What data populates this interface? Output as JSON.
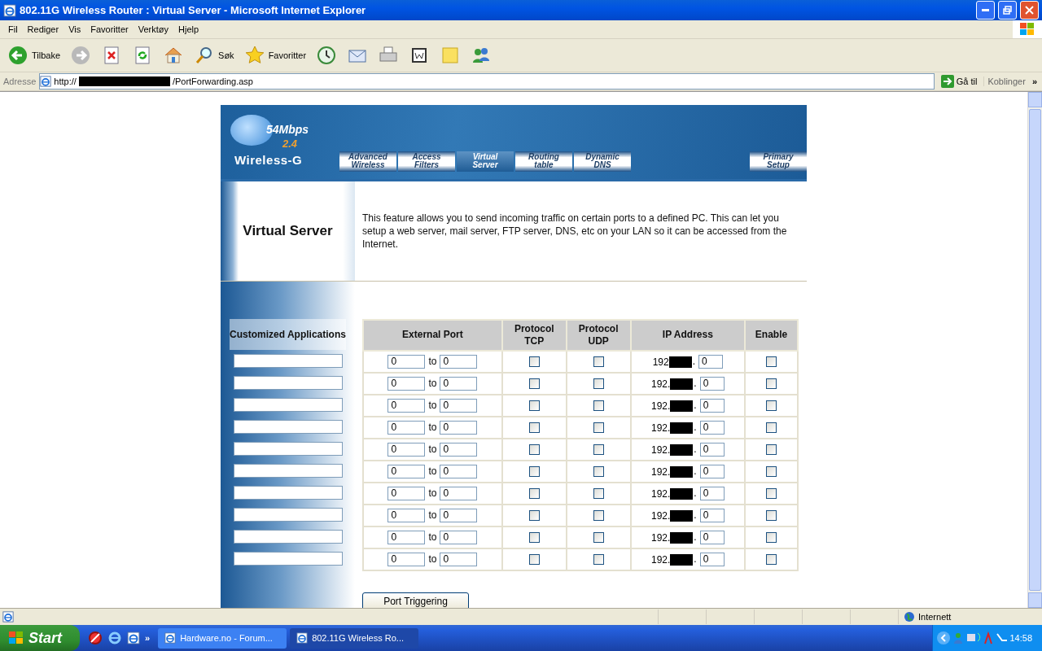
{
  "window": {
    "title": "802.11G Wireless Router : Virtual Server - Microsoft Internet Explorer"
  },
  "menu": [
    "Fil",
    "Rediger",
    "Vis",
    "Favoritter",
    "Verktøy",
    "Hjelp"
  ],
  "toolbar": [
    {
      "kind": "back",
      "label": "Tilbake"
    },
    {
      "kind": "forward"
    },
    {
      "kind": "stop"
    },
    {
      "kind": "refresh"
    },
    {
      "kind": "home"
    },
    {
      "kind": "search",
      "label": "Søk"
    },
    {
      "kind": "favorites",
      "label": "Favoritter"
    },
    {
      "kind": "history"
    },
    {
      "kind": "mail"
    },
    {
      "kind": "print"
    },
    {
      "kind": "edit"
    },
    {
      "kind": "note"
    },
    {
      "kind": "messenger"
    }
  ],
  "address": {
    "label": "Adresse",
    "url_prefix": "http://",
    "url_suffix": "/PortForwarding.asp",
    "go": "Gå til",
    "links": "Koblinger",
    "more": "»"
  },
  "router": {
    "logo": {
      "speed": "54Mbps",
      "band": "2.4",
      "name": "Wireless-G"
    },
    "tabs": [
      {
        "label": "Advanced\nWireless",
        "selected": false
      },
      {
        "label": "Access\nFilters",
        "selected": false
      },
      {
        "label": "Virtual\nServer",
        "selected": true
      },
      {
        "label": "Routing\ntable",
        "selected": false
      },
      {
        "label": "Dynamic\nDNS",
        "selected": false
      }
    ],
    "primary_tab": "Primary\nSetup",
    "section_title": "Virtual Server",
    "description": "This feature allows you to send incoming traffic on certain ports to a defined PC. This can let you setup a web server, mail server, FTP server, DNS, etc on your LAN so it can be accessed from the Internet.",
    "apps_label": "Customized Applications",
    "columns": [
      "External Port",
      "Protocol\nTCP",
      "Protocol\nUDP",
      "IP Address",
      "Enable"
    ],
    "rows": [
      {
        "port_from": "0",
        "to": "to",
        "port_to": "0",
        "tcp": false,
        "udp": false,
        "ip_prefix": "192",
        "ip_sep": ".",
        "ip_last": "0",
        "enable": false
      },
      {
        "port_from": "0",
        "to": "to",
        "port_to": "0",
        "tcp": false,
        "udp": false,
        "ip_prefix": "192.",
        "ip_sep": ".",
        "ip_last": "0",
        "enable": false
      },
      {
        "port_from": "0",
        "to": "to",
        "port_to": "0",
        "tcp": false,
        "udp": false,
        "ip_prefix": "192.",
        "ip_sep": ".",
        "ip_last": "0",
        "enable": false
      },
      {
        "port_from": "0",
        "to": "to",
        "port_to": "0",
        "tcp": false,
        "udp": false,
        "ip_prefix": "192.",
        "ip_sep": ".",
        "ip_last": "0",
        "enable": false
      },
      {
        "port_from": "0",
        "to": "to",
        "port_to": "0",
        "tcp": false,
        "udp": false,
        "ip_prefix": "192.",
        "ip_sep": ".",
        "ip_last": "0",
        "enable": false
      },
      {
        "port_from": "0",
        "to": "to",
        "port_to": "0",
        "tcp": false,
        "udp": false,
        "ip_prefix": "192.",
        "ip_sep": ".",
        "ip_last": "0",
        "enable": false
      },
      {
        "port_from": "0",
        "to": "to",
        "port_to": "0",
        "tcp": false,
        "udp": false,
        "ip_prefix": "192.",
        "ip_sep": ".",
        "ip_last": "0",
        "enable": false
      },
      {
        "port_from": "0",
        "to": "to",
        "port_to": "0",
        "tcp": false,
        "udp": false,
        "ip_prefix": "192.",
        "ip_sep": ".",
        "ip_last": "0",
        "enable": false
      },
      {
        "port_from": "0",
        "to": "to",
        "port_to": "0",
        "tcp": false,
        "udp": false,
        "ip_prefix": "192.",
        "ip_sep": ".",
        "ip_last": "0",
        "enable": false
      },
      {
        "port_from": "0",
        "to": "to",
        "port_to": "0",
        "tcp": false,
        "udp": false,
        "ip_prefix": "192.",
        "ip_sep": ".",
        "ip_last": "0",
        "enable": false
      }
    ],
    "button": "Port Triggering"
  },
  "status_bar": {
    "zone": "Internett"
  },
  "taskbar": {
    "start": "Start",
    "more": "»",
    "tasks": [
      {
        "label": "Hardware.no - Forum...",
        "selected": false
      },
      {
        "label": "802.11G Wireless Ro...",
        "selected": true
      }
    ],
    "clock": "14:58"
  }
}
